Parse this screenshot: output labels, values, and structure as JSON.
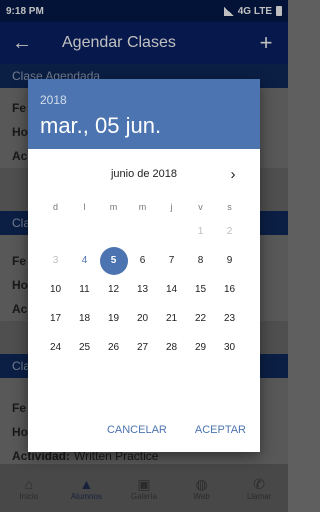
{
  "status_bar": {
    "time": "9:18 PM",
    "network": "4G LTE"
  },
  "app_bar": {
    "title": "Agendar Clases"
  },
  "cards": [
    {
      "header": "Clase Agendada",
      "rows": [
        {
          "label": "Fe",
          "value": ""
        },
        {
          "label": "Ho",
          "value": ""
        },
        {
          "label": "Ac",
          "value": ""
        }
      ]
    },
    {
      "header": "Cla",
      "rows": [
        {
          "label": "Fe",
          "value": ""
        },
        {
          "label": "Ho",
          "value": ""
        },
        {
          "label": "Ac",
          "value": ""
        }
      ]
    },
    {
      "header": "Cla",
      "rows": [
        {
          "label": "Fe",
          "value": ""
        },
        {
          "label": "Ho",
          "value": ""
        },
        {
          "label": "Actividad:",
          "value": "Written Practice"
        }
      ]
    }
  ],
  "bottom_nav": [
    {
      "label": "Inicio",
      "icon": "home-icon",
      "active": false
    },
    {
      "label": "Alumnos",
      "icon": "graduation-cap-icon",
      "active": true
    },
    {
      "label": "Galería",
      "icon": "image-icon",
      "active": false
    },
    {
      "label": "Web",
      "icon": "globe-icon",
      "active": false
    },
    {
      "label": "Llamar",
      "icon": "phone-icon",
      "active": false
    }
  ],
  "date_picker": {
    "year": "2018",
    "selected_date_label": "mar., 05 jun.",
    "month_label": "junio de 2018",
    "weekdays": [
      "d",
      "l",
      "m",
      "m",
      "j",
      "v",
      "s"
    ],
    "leading_blanks": 5,
    "days": [
      "1",
      "2",
      "3",
      "4",
      "5",
      "6",
      "7",
      "8",
      "9",
      "10",
      "11",
      "12",
      "13",
      "14",
      "15",
      "16",
      "17",
      "18",
      "19",
      "20",
      "21",
      "22",
      "23",
      "24",
      "25",
      "26",
      "27",
      "28",
      "29",
      "30"
    ],
    "disabled_days": [
      "1",
      "2",
      "3"
    ],
    "today_day": "4",
    "selected_day": "5",
    "cancel_label": "CANCELAR",
    "ok_label": "ACEPTAR",
    "accent_color": "#4c74b0"
  }
}
